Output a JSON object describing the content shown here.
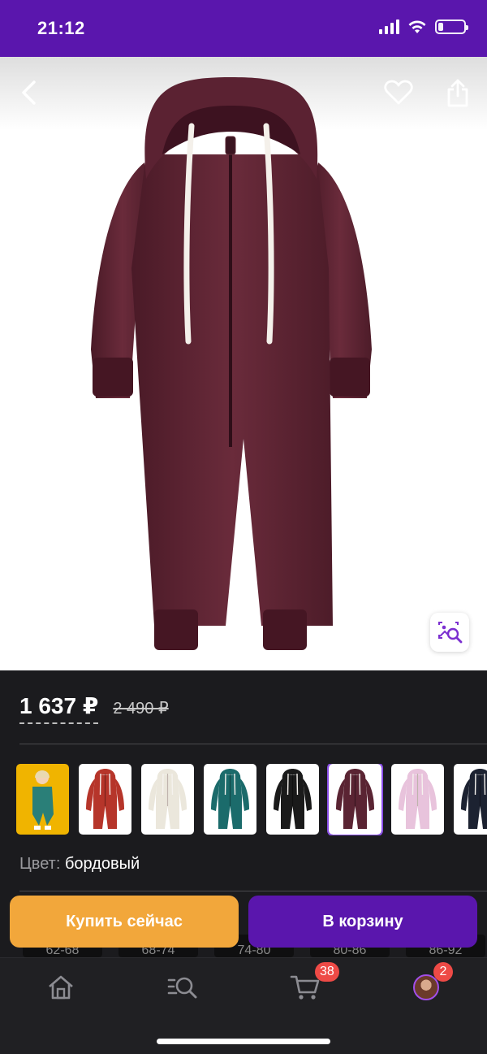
{
  "status_bar": {
    "time": "21:12",
    "battery_level": 0.2
  },
  "product": {
    "price_current": "1 637 ₽",
    "price_old": "2 490 ₽",
    "color_label": "Цвет:",
    "color_value": "бордовый",
    "main_color": "#5a2433",
    "swatch_colors": [
      "#2a7f78",
      "#b6352a",
      "#ebe7dc",
      "#1b6b6b",
      "#1a1a1a",
      "#5a2433",
      "#e8c3dc",
      "#1c2231"
    ],
    "selected_swatch": 5
  },
  "sizes": [
    "62-68",
    "68-74",
    "74-80",
    "80-86",
    "86-92"
  ],
  "actions": {
    "buy_now": "Купить сейчас",
    "add_to_cart": "В корзину"
  },
  "tab_bar": {
    "items": [
      {
        "icon": "home-icon"
      },
      {
        "icon": "catalog-search-icon"
      },
      {
        "icon": "cart-icon",
        "badge": "38"
      },
      {
        "icon": "profile-avatar",
        "badge": "2"
      }
    ]
  },
  "colors": {
    "brand_purple": "#5a16ad",
    "buy_orange": "#f2a73b",
    "badge_red": "#ee4a46",
    "background": "#1b1b1e"
  }
}
